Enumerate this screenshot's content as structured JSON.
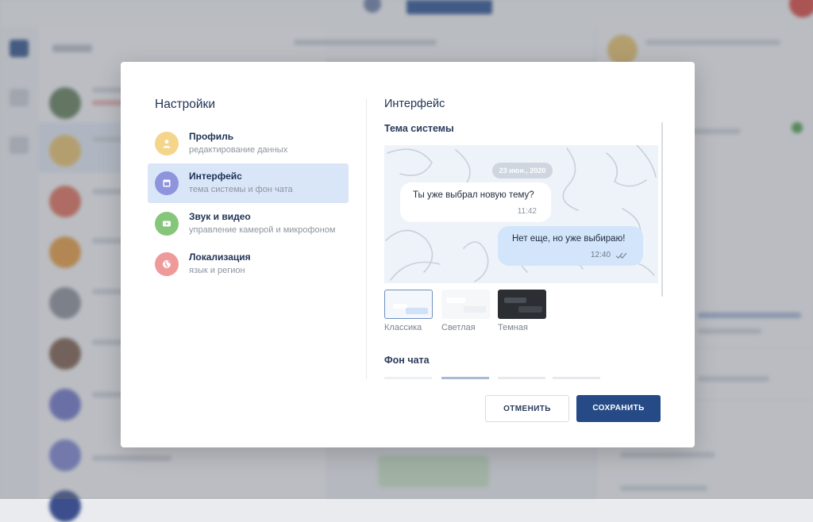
{
  "settings": {
    "title": "Настройки",
    "menu": [
      {
        "label": "Профиль",
        "sub": "редактирование данных",
        "color": "#f5d58a"
      },
      {
        "label": "Интерфейс",
        "sub": "тема системы и фон чата",
        "color": "#8f95dd",
        "active": true
      },
      {
        "label": "Звук и видео",
        "sub": "управление камерой и микрофоном",
        "color": "#86c67a"
      },
      {
        "label": "Локализация",
        "sub": "язык и регион",
        "color": "#ee9a9a"
      }
    ]
  },
  "interface": {
    "title": "Интерфейс",
    "theme_section": "Тема системы",
    "preview": {
      "date": "23 июн., 2020",
      "incoming_text": "Ты уже выбрал новую тему?",
      "incoming_time": "11:42",
      "outgoing_text": "Нет еще, но уже выбираю!",
      "outgoing_time": "12:40"
    },
    "themes": [
      {
        "label": "Классика",
        "selected": true
      },
      {
        "label": "Светлая"
      },
      {
        "label": "Темная"
      }
    ],
    "background_section": "Фон чата"
  },
  "buttons": {
    "cancel": "ОТМЕНИТЬ",
    "save": "СОХРАНИТЬ"
  }
}
